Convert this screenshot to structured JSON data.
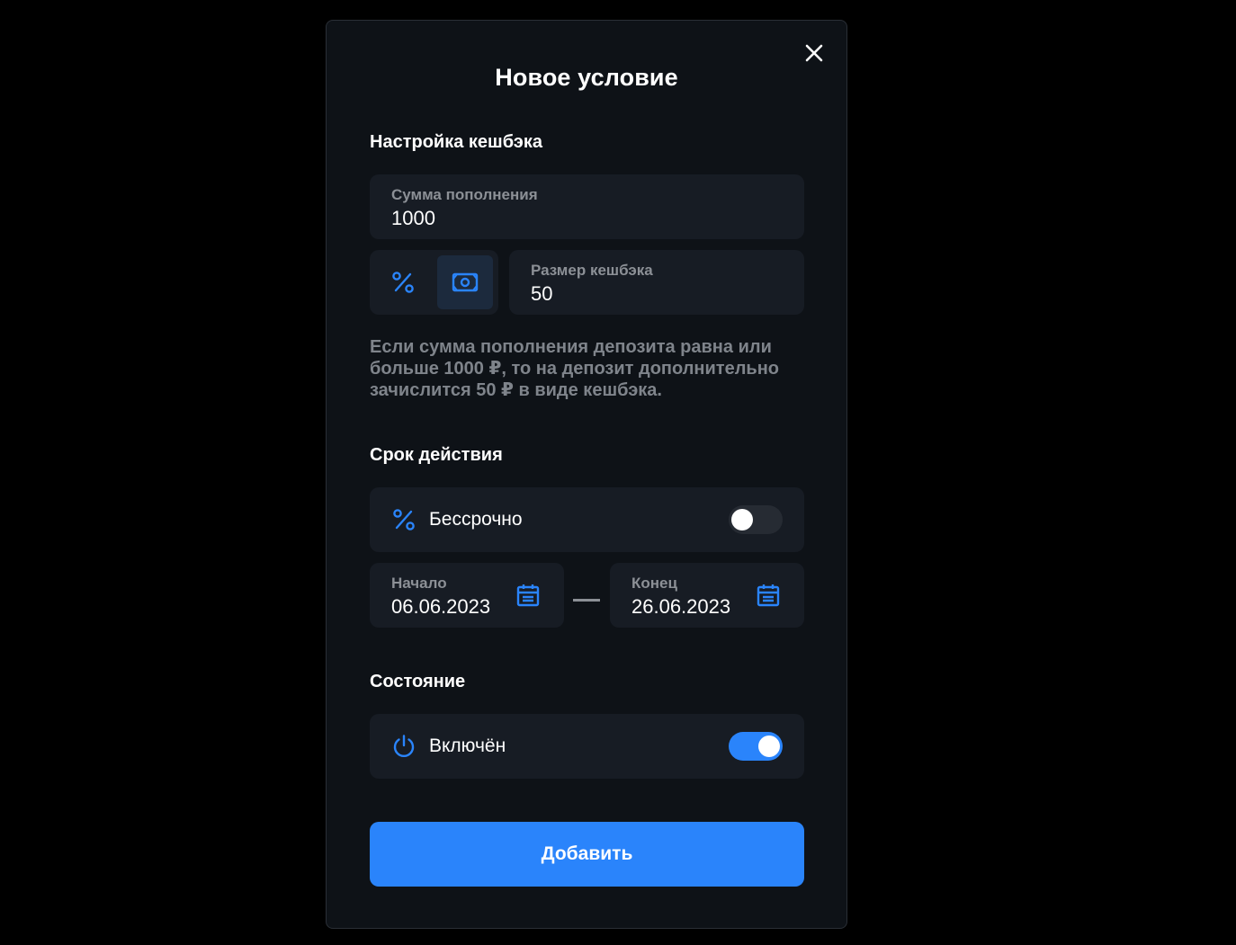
{
  "modal": {
    "title": "Новое условие",
    "close_icon": "close-icon"
  },
  "cashback": {
    "section_title": "Настройка кешбэка",
    "amount_label": "Сумма пополнения",
    "amount_value": "1000",
    "type_options": [
      {
        "icon": "percent-icon",
        "active": false
      },
      {
        "icon": "banknote-icon",
        "active": true
      }
    ],
    "size_label": "Размер кешбэка",
    "size_value": "50",
    "hint": "Если сумма пополнения депозита равна или больше 1000 ₽, то на депозит дополнительно зачислится 50 ₽ в виде кешбэка."
  },
  "validity": {
    "section_title": "Срок действия",
    "unlimited_label": "Бессрочно",
    "unlimited_icon": "percent-icon",
    "unlimited_on": false,
    "start_label": "Начало",
    "start_value": "06.06.2023",
    "end_label": "Конец",
    "end_value": "26.06.2023",
    "calendar_icon": "calendar-icon"
  },
  "state": {
    "section_title": "Состояние",
    "enabled_label": "Включён",
    "enabled_icon": "power-icon",
    "enabled_on": true
  },
  "submit_label": "Добавить",
  "colors": {
    "background": "#000000",
    "modal": "#0e1217",
    "field": "#171c24",
    "accent": "#2a84fb",
    "muted_text": "#8c9096"
  }
}
